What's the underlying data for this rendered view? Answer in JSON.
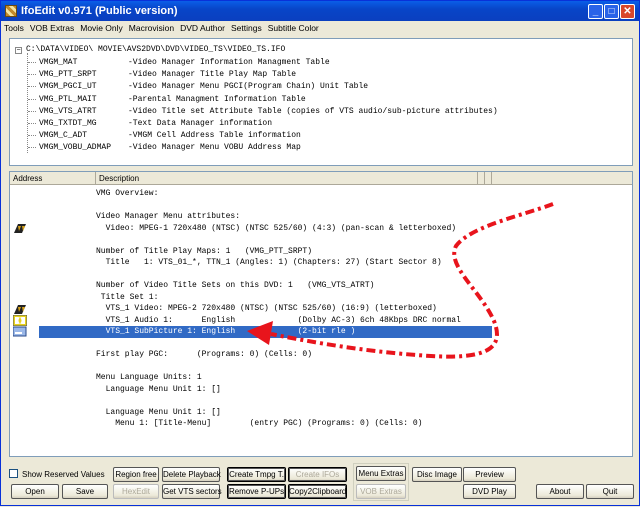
{
  "window": {
    "title": "IfoEdit v0.971 (Public version)",
    "minimize": "_",
    "maximize": "□",
    "close": "✕"
  },
  "menu": [
    "Tools",
    "VOB Extras",
    "Movie Only",
    "Macrovision",
    "DVD Author",
    "Settings",
    "Subtitle Color"
  ],
  "tree": {
    "root": "C:\\DATA\\VIDEO\\ MOVIE\\AVS2DVD\\DVD\\VIDEO_TS\\VIDEO_TS.IFO",
    "items": [
      {
        "name": "VMGM_MAT",
        "desc": "-Video Manager Information Managment Table"
      },
      {
        "name": "VMG_PTT_SRPT",
        "desc": "-Video Manager Title Play Map Table"
      },
      {
        "name": "VMGM_PGCI_UT",
        "desc": "-Video Manager Menu PGCI(Program Chain) Unit Table"
      },
      {
        "name": "VMG_PTL_MAIT",
        "desc": "-Parental Managment Information Table"
      },
      {
        "name": "VMG_VTS_ATRT",
        "desc": "-Video Title set Attribute Table (copies of VTS audio/sub-picture attributes)"
      },
      {
        "name": "VMG_TXTDT_MG",
        "desc": "-Text Data Manager information"
      },
      {
        "name": "VMGM_C_ADT",
        "desc": "-VMGM Cell Address Table information"
      },
      {
        "name": "VMGM_VOBU_ADMAP",
        "desc": "-Video Manager Menu VOBU Address Map"
      }
    ]
  },
  "list": {
    "headers": [
      "Address",
      "Description"
    ],
    "rows": [
      "VMG Overview:",
      "",
      "Video Manager Menu attributes:",
      "  Video: MPEG-1 720x480 (NTSC) (NTSC 525/60) (4:3) (pan-scan & letterboxed)",
      "",
      "Number of Title Play Maps: 1   (VMG_PTT_SRPT)",
      "  Title   1: VTS_01_*, TTN_1 (Angles: 1) (Chapters: 27) (Start Sector 8)",
      "",
      "Number of Video Title Sets on this DVD: 1   (VMG_VTS_ATRT)",
      " Title Set 1:",
      "  VTS_1 Video: MPEG-2 720x480 (NTSC) (NTSC 525/60) (16:9) (letterboxed)",
      "  VTS_1 Audio 1:      English             (Dolby AC-3) 6ch 48Kbps DRC normal",
      "  VTS_1 SubPicture 1: English             (2-bit rle )",
      "",
      "First play PGC:      (Programs: 0) (Cells: 0)",
      "",
      "Menu Language Units: 1",
      "  Language Menu Unit 1: []",
      "",
      "  Language Menu Unit 1: []",
      "    Menu 1: [Title-Menu]        (entry PGC) (Programs: 0) (Cells: 0)"
    ],
    "selected_row": 12
  },
  "controls": {
    "show_reserved": "Show Reserved Values",
    "region_free": "Region free",
    "delete_playback": "Delete Playback",
    "create_tmpg": "Create Tmpg T.",
    "create_ifos": "Create IFOs",
    "menu_extras": "Menu Extras",
    "disc_image": "Disc Image",
    "preview": "Preview",
    "open": "Open",
    "save": "Save",
    "hexedit": "HexEdit",
    "get_vts": "Get VTS sectors",
    "remove_pups": "Remove P-UPs",
    "copy2clipboard": "Copy2Clipboard",
    "vob_extras": "VOB Extras",
    "dvd_play": "DVD Play",
    "about": "About",
    "quit": "Quit"
  },
  "colors": {
    "selection": "#316ac5",
    "annotation": "#e8141c"
  }
}
